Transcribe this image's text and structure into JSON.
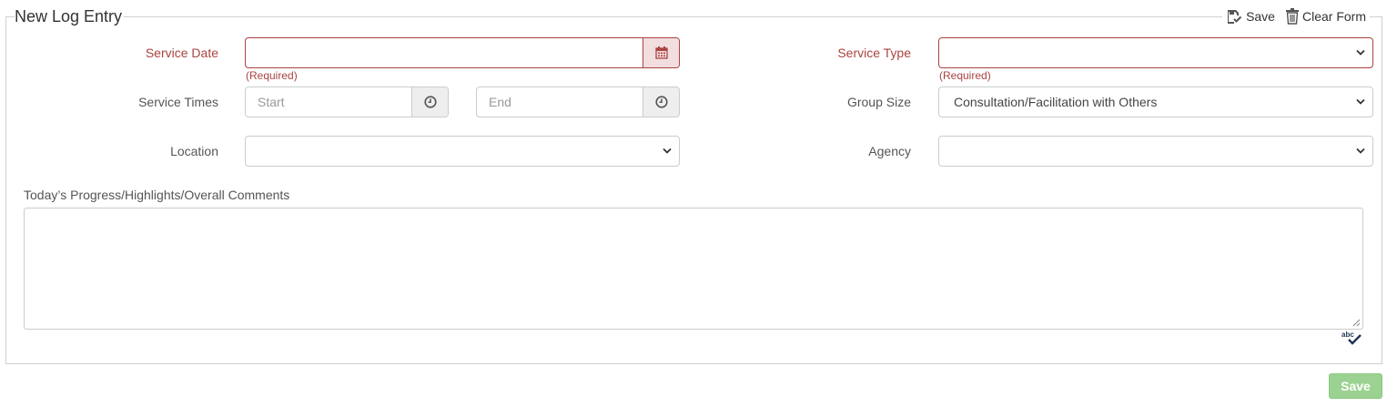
{
  "form": {
    "legend": "New Log Entry",
    "toolbar": {
      "save_label": "Save",
      "clear_label": "Clear Form"
    },
    "service_date": {
      "label": "Service Date",
      "value": "",
      "help": "(Required)"
    },
    "service_type": {
      "label": "Service Type",
      "selected": "",
      "help": "(Required)"
    },
    "service_times": {
      "label": "Service Times",
      "start_placeholder": "Start",
      "end_placeholder": "End"
    },
    "group_size": {
      "label": "Group Size",
      "selected": "Consultation/Facilitation with Others"
    },
    "location": {
      "label": "Location",
      "selected": ""
    },
    "agency": {
      "label": "Agency",
      "selected": ""
    },
    "comments": {
      "label": "Today’s Progress/Highlights/Overall Comments",
      "value": ""
    }
  },
  "footer": {
    "save_label": "Save"
  },
  "colors": {
    "error": "#a94442",
    "save_button": "#9bd291",
    "border": "#cccccc"
  },
  "icons": [
    "save-icon",
    "trash-icon",
    "calendar-icon",
    "clock-icon",
    "chevron-down-icon",
    "spellcheck-icon"
  ]
}
